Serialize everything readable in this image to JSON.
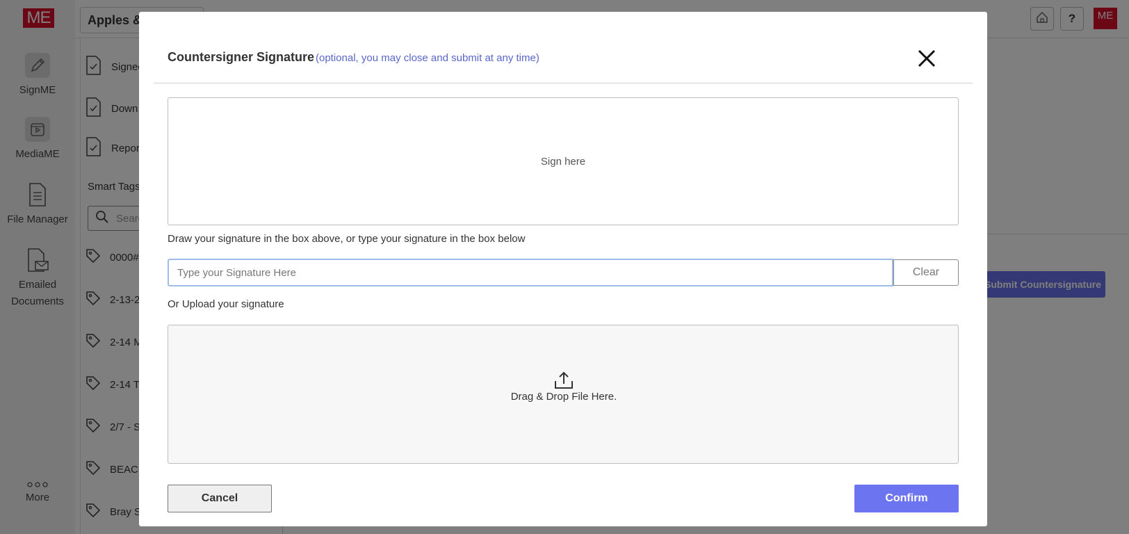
{
  "app": {
    "logo_text": "ME",
    "nav": [
      {
        "label": "SignME",
        "icon": "pen-icon"
      },
      {
        "label": "MediaME",
        "icon": "media-icon"
      },
      {
        "label": "File Manager",
        "icon": "document-icon"
      },
      {
        "label": "Emailed Documents",
        "icon": "emailed-documents-icon"
      },
      {
        "label": "More",
        "icon": "more-dots-icon"
      }
    ],
    "folder_title": "Apples & ",
    "top_buttons": [
      {
        "name": "home-button",
        "icon": "home-icon"
      },
      {
        "name": "help-button",
        "label": "?"
      }
    ],
    "brand_mark": "ME",
    "panel": {
      "items": [
        "Signed",
        "Down",
        "Repor"
      ],
      "smart_tags_label": "Smart Tags",
      "search_placeholder": "Searc",
      "tags": [
        "0000#",
        "2-13-2",
        "2-14 M",
        "2-14 T",
        "2/7 - S",
        "BEACI",
        "Bray S"
      ]
    },
    "submit_countersignature_label": "Submit Countersignature"
  },
  "modal": {
    "title": "Countersigner Signature",
    "subtitle": "(optional, you may close and submit at any time)",
    "sign_pad_text": "Sign here",
    "instructions": "Draw your signature in the box above, or type your signature in the box below",
    "signature_input": {
      "value": "",
      "placeholder": "Type your Signature Here"
    },
    "clear_label": "Clear",
    "upload_label": "Or Upload your signature",
    "dropzone_text": "Drag & Drop File Here.",
    "cancel_label": "Cancel",
    "confirm_label": "Confirm"
  },
  "colors": {
    "accent": "#6d74ef",
    "subtitle": "#5a66c8",
    "brand_red": "#d8102a"
  }
}
